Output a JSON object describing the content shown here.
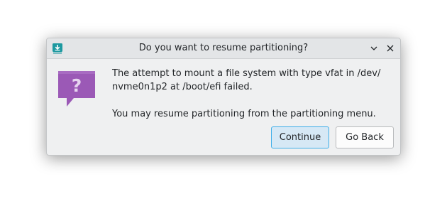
{
  "window": {
    "title": "Do you want to resume partitioning?",
    "app_icon": "installer-download-icon"
  },
  "titlebar": {
    "minimize_icon": "chevron-down-icon",
    "close_icon": "close-icon"
  },
  "dialog": {
    "icon": "question-icon",
    "icon_color": "#9b59b6",
    "message_line1": "The attempt to mount a file system with type vfat in /dev/ nvme0n1p2 at /boot/efi failed.",
    "message_line2": "You may resume partitioning from the partitioning menu."
  },
  "buttons": {
    "continue_label": "Continue",
    "go_back_label": "Go Back"
  },
  "colors": {
    "accent": "#3daee9",
    "focus_fill": "#d6e8f5",
    "app_icon_teal": "#1d99a0"
  }
}
